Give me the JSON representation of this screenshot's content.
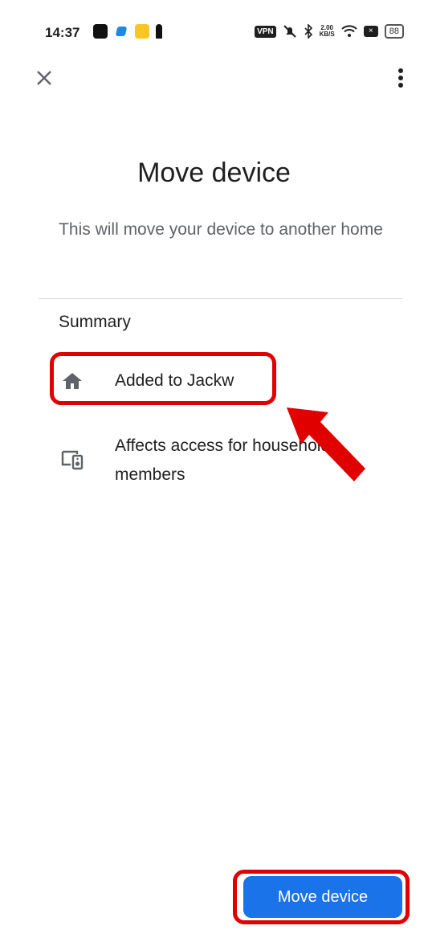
{
  "status": {
    "time": "14:37",
    "vpn": "VPN",
    "speed_value": "2.00",
    "speed_unit": "KB/S",
    "battery": "88"
  },
  "header": {
    "close_icon": "close-icon",
    "more_icon": "more-vert-icon"
  },
  "page": {
    "title": "Move device",
    "subtitle": "This will move your device to another home"
  },
  "summary": {
    "heading": "Summary",
    "items": [
      {
        "icon": "home-icon",
        "label": "Added to Jackw"
      },
      {
        "icon": "devices-icon",
        "label": "Affects access for household members"
      }
    ]
  },
  "actions": {
    "primary_label": "Move device"
  },
  "annotations": {
    "highlight_color": "#e00000"
  },
  "colors": {
    "accent": "#1a73e8",
    "text_primary": "#1f1f1f",
    "text_secondary": "#5f6368"
  }
}
